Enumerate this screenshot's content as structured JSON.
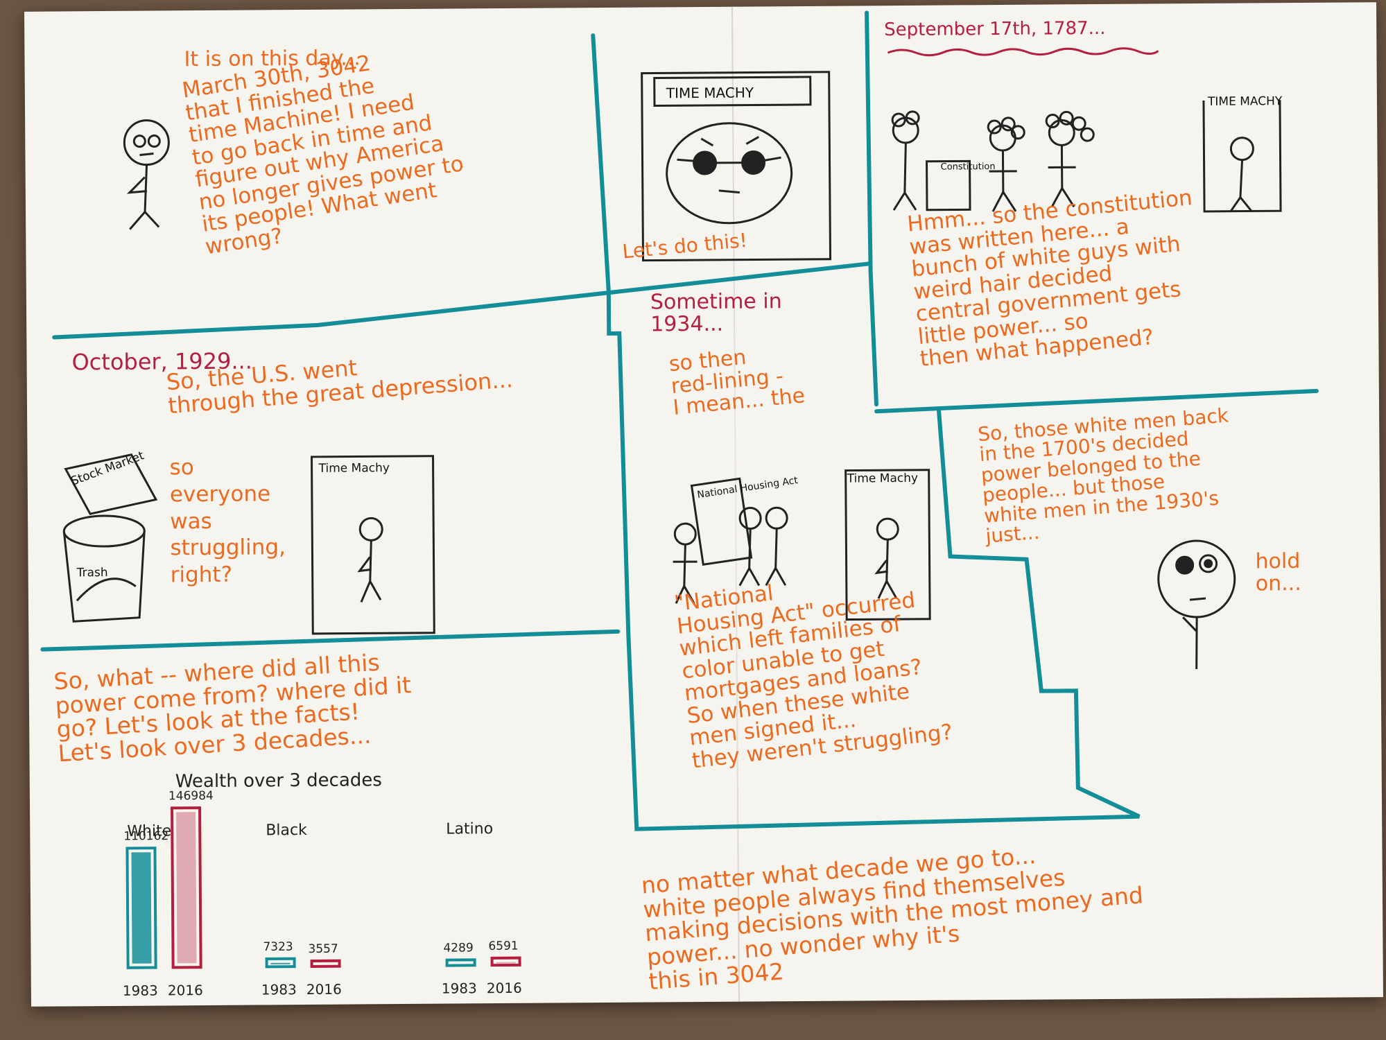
{
  "panel1": {
    "heading": "It is on this day...",
    "body": "March 30th, 3042\nthat I finished the\ntime Machine! I need\nto go back in time and\nfigure out why America\nno longer gives power to\nits people! What went\nwrong?"
  },
  "panel2": {
    "label": "TIME MACHY",
    "caption": "Let's do this!"
  },
  "panel3": {
    "date": "September 17th, 1787...",
    "sign": "Constitution",
    "label": "TIME MACHY",
    "body": "Hmm... so the constitution\nwas written here... a\nbunch of white guys with\nweird hair decided\ncentral government gets\nlittle power... so\nthen what happened?"
  },
  "panel4": {
    "date": "October, 1929...",
    "body": "So, the U.S. went\nthrough the great depression...",
    "side": "so\neveryone\nwas\nstruggling,\nright?",
    "sign": "Stock\nMarket",
    "trash": "Trash",
    "label": "Time Machy"
  },
  "panel5": {
    "date": "Sometime in\n1934...",
    "intro": "so then\nred-lining -\nI mean... the",
    "sign": "National\nHousing\nAct",
    "label": "Time Machy",
    "body": "\"National\nHousing Act\" occurred\nwhich left families of\ncolor unable to get\nmortgages and loans?\nSo when these white\nmen signed it...\nthey weren't struggling?"
  },
  "panel6": {
    "body": "So, those white men back\nin the 1700's decided\npower belonged to the\npeople... but those\nwhite men in the 1930's\njust...",
    "aside": "hold\non..."
  },
  "panel7": {
    "body": "So, what -- where did all this\npower come from? where did it\ngo? Let's look at the facts!\nLet's look over 3 decades..."
  },
  "closing": {
    "body": "no matter what decade we go to...\nwhite people always find themselves\nmaking decisions with the most money and\npower... no wonder why it's\nthis in 3042"
  },
  "chart_data": {
    "type": "bar",
    "title": "Wealth over 3 decades",
    "groups": [
      "White",
      "Black",
      "Latino"
    ],
    "series": [
      {
        "name": "1983",
        "values": [
          110162,
          7323,
          4289
        ]
      },
      {
        "name": "2016",
        "values": [
          146984,
          3557,
          6591
        ]
      }
    ],
    "value_labels": [
      [
        "110162",
        "146984"
      ],
      [
        "7323",
        "3557"
      ],
      [
        "4289",
        "6591"
      ]
    ],
    "year_labels": [
      "1983",
      "2016"
    ],
    "colors": {
      "1983": "#138e99",
      "2016": "#b51f3f"
    }
  }
}
